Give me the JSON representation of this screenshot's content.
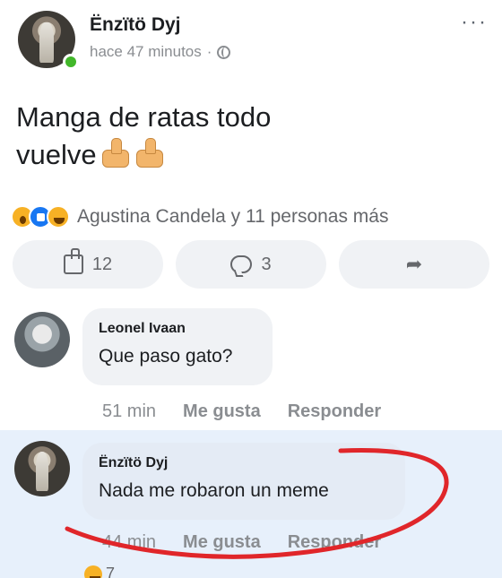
{
  "post": {
    "author": "Ënzïtö Dyj",
    "time": "hace 47 minutos",
    "separator": "·",
    "text_line1": "Manga de ratas todo",
    "text_line2": "vuelve",
    "reactions_text": "Agustina Candela y 11 personas más",
    "likes_count": "12",
    "comments_count": "3"
  },
  "comments": [
    {
      "author": "Leonel Ivaan",
      "text": "Que paso gato?",
      "time": "51 min",
      "like_label": "Me gusta",
      "reply_label": "Responder"
    },
    {
      "author": "Ënzïtö Dyj",
      "text": "Nada me robaron un meme",
      "time": "44 min",
      "like_label": "Me gusta",
      "reply_label": "Responder",
      "reaction_count": "7"
    }
  ],
  "colors": {
    "accent_blue": "#1877f2",
    "online_green": "#42b72a",
    "annotation_red": "#e0262a",
    "highlight_bg": "#e7f0fb"
  }
}
